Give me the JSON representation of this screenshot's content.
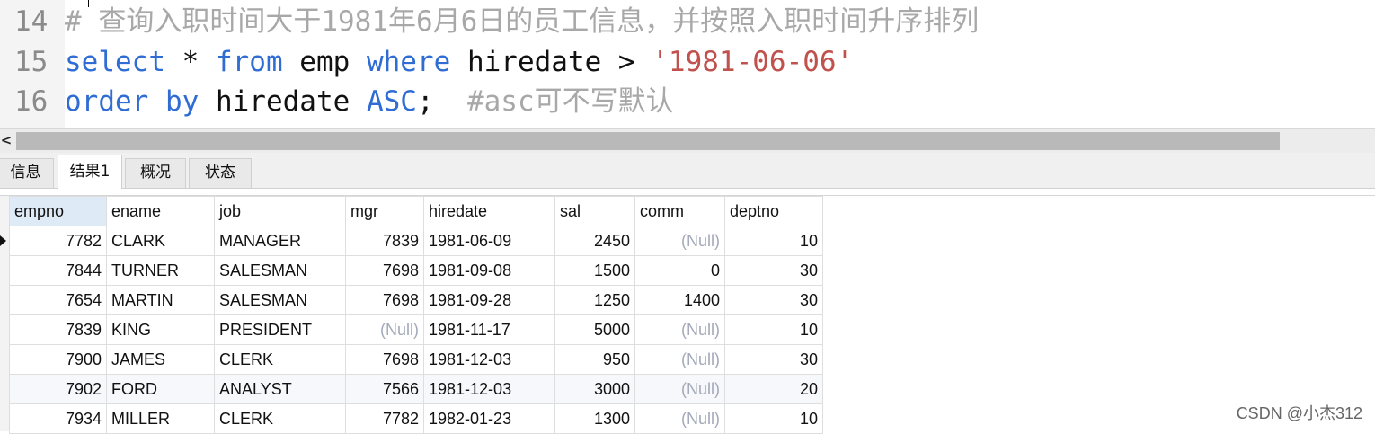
{
  "editor": {
    "lines": [
      {
        "number": "14",
        "tokens": [
          {
            "type": "cmt",
            "text": "# 查询入职时间大于1981年6月6日的员工信息，并按照入职时间升序排列"
          }
        ]
      },
      {
        "number": "15",
        "tokens": [
          {
            "type": "kw",
            "text": "select"
          },
          {
            "type": "id",
            "text": " * "
          },
          {
            "type": "kw",
            "text": "from"
          },
          {
            "type": "id",
            "text": " emp "
          },
          {
            "type": "kw",
            "text": "where"
          },
          {
            "type": "id",
            "text": " hiredate > "
          },
          {
            "type": "str",
            "text": "'1981-06-06'"
          }
        ]
      },
      {
        "number": "16",
        "tokens": [
          {
            "type": "kw",
            "text": "order by"
          },
          {
            "type": "id",
            "text": " hiredate "
          },
          {
            "type": "kw",
            "text": "ASC"
          },
          {
            "type": "id",
            "text": ";  "
          },
          {
            "type": "cmt",
            "text": "#asc可不写默认"
          }
        ]
      }
    ]
  },
  "scrollbar": {
    "left_arrow": "<"
  },
  "tabs": [
    {
      "label": "信息",
      "active": false
    },
    {
      "label": "结果1",
      "active": true
    },
    {
      "label": "概况",
      "active": false
    },
    {
      "label": "状态",
      "active": false
    }
  ],
  "grid": {
    "columns": [
      {
        "label": "empno",
        "width": 108
      },
      {
        "label": "ename",
        "width": 120
      },
      {
        "label": "job",
        "width": 146
      },
      {
        "label": "mgr",
        "width": 87
      },
      {
        "label": "hiredate",
        "width": 146
      },
      {
        "label": "sal",
        "width": 89
      },
      {
        "label": "comm",
        "width": 100
      },
      {
        "label": "deptno",
        "width": 109
      }
    ],
    "null_text": "(Null)",
    "rows": [
      [
        "7782",
        "CLARK",
        "MANAGER",
        "7839",
        "1981-06-09",
        "2450",
        null,
        "10"
      ],
      [
        "7844",
        "TURNER",
        "SALESMAN",
        "7698",
        "1981-09-08",
        "1500",
        "0",
        "30"
      ],
      [
        "7654",
        "MARTIN",
        "SALESMAN",
        "7698",
        "1981-09-28",
        "1250",
        "1400",
        "30"
      ],
      [
        "7839",
        "KING",
        "PRESIDENT",
        null,
        "1981-11-17",
        "5000",
        null,
        "10"
      ],
      [
        "7900",
        "JAMES",
        "CLERK",
        "7698",
        "1981-12-03",
        "950",
        null,
        "30"
      ],
      [
        "7902",
        "FORD",
        "ANALYST",
        "7566",
        "1981-12-03",
        "3000",
        null,
        "20"
      ],
      [
        "7934",
        "MILLER",
        "CLERK",
        "7782",
        "1982-01-23",
        "1300",
        null,
        "10"
      ]
    ]
  },
  "watermark": "CSDN @小杰312"
}
